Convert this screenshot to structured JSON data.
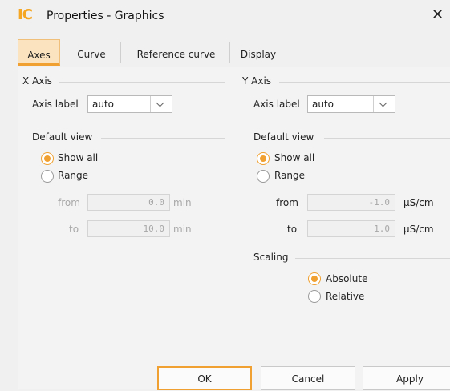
{
  "window": {
    "logo_text": "IC",
    "title": "Properties - Graphics",
    "close_glyph": "✕"
  },
  "tabs": [
    {
      "label": "Axes",
      "active": true
    },
    {
      "label": "Curve"
    },
    {
      "label": "Reference curve"
    },
    {
      "label": "Display"
    }
  ],
  "x_axis": {
    "group_label": "X Axis",
    "axis_label_caption": "Axis label",
    "axis_label_value": "auto",
    "default_view_label": "Default view",
    "options": [
      "Show all",
      "Range"
    ],
    "selected": "Show all",
    "from_label": "from",
    "from_value": "0.0",
    "from_unit": "min",
    "to_label": "to",
    "to_value": "10.0",
    "to_unit": "min"
  },
  "y_axis": {
    "group_label": "Y Axis",
    "axis_label_caption": "Axis label",
    "axis_label_value": "auto",
    "default_view_label": "Default view",
    "options": [
      "Show all",
      "Range"
    ],
    "selected": "Show all",
    "from_label": "from",
    "from_value": "-1.0",
    "from_unit": "µS/cm",
    "to_label": "to",
    "to_value": "1.0",
    "to_unit": "µS/cm",
    "scaling_label": "Scaling",
    "scaling_options": [
      "Absolute",
      "Relative"
    ],
    "scaling_selected": "Absolute"
  },
  "buttons": {
    "ok": "OK",
    "cancel": "Cancel",
    "apply": "Apply"
  },
  "colors": {
    "accent": "#f0a030",
    "tab_active_bg": "#fbe3bf"
  }
}
